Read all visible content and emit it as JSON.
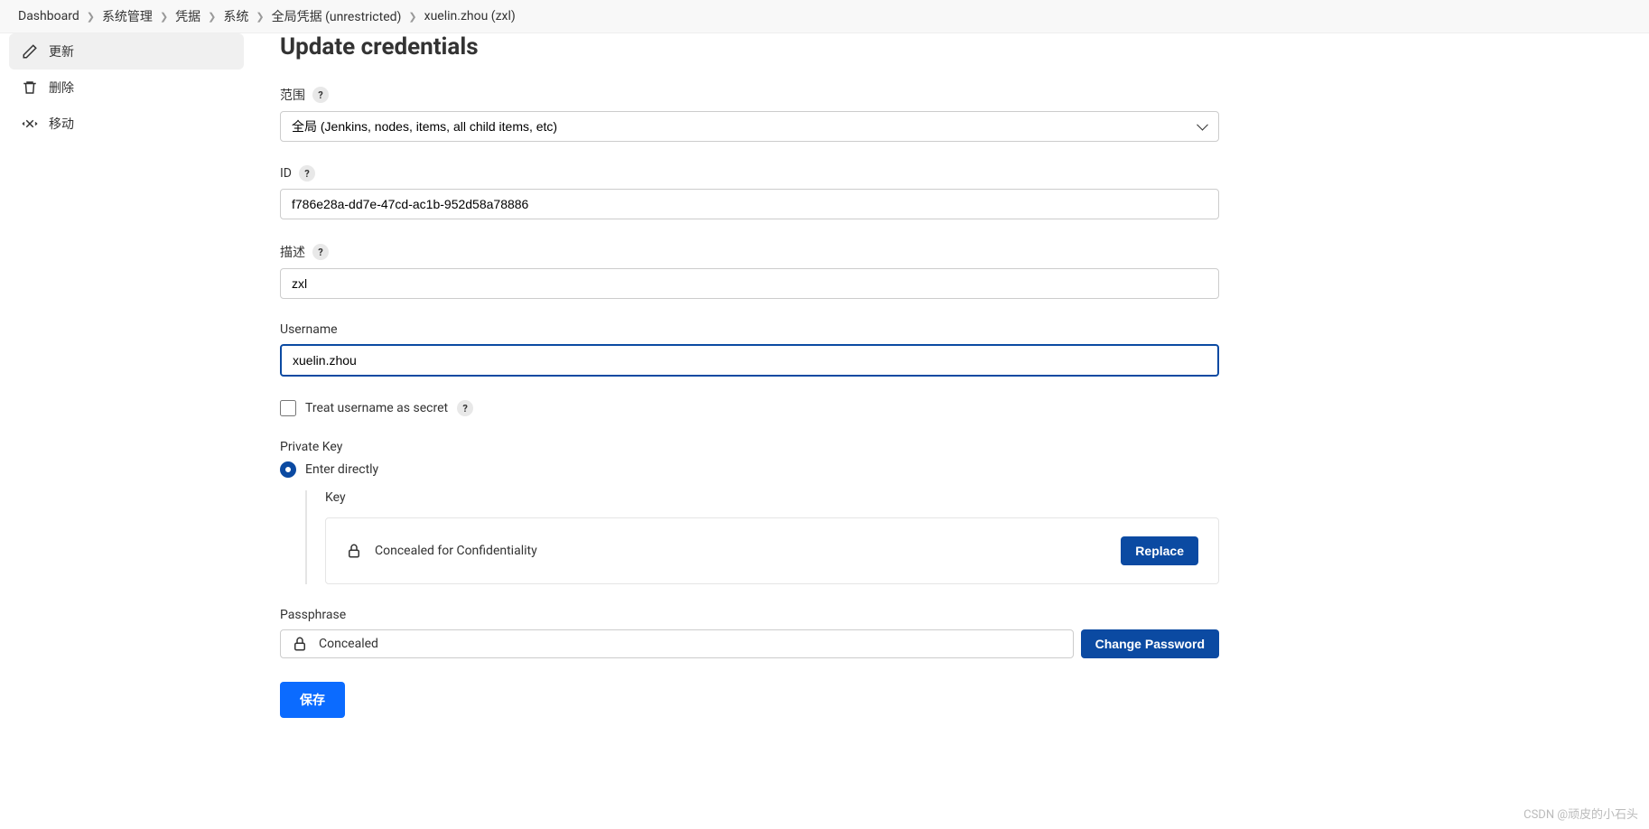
{
  "breadcrumb": [
    "Dashboard",
    "系统管理",
    "凭据",
    "系统",
    "全局凭据 (unrestricted)",
    "xuelin.zhou (zxl)"
  ],
  "sidebar": {
    "update": "更新",
    "delete": "删除",
    "move": "移动"
  },
  "page": {
    "title": "Update credentials"
  },
  "form": {
    "scope_label": "范围",
    "scope_value": "全局 (Jenkins, nodes, items, all child items, etc)",
    "id_label": "ID",
    "id_value": "f786e28a-dd7e-47cd-ac1b-952d58a78886",
    "desc_label": "描述",
    "desc_value": "zxl",
    "username_label": "Username",
    "username_value": "xuelin.zhou",
    "treat_secret_label": "Treat username as secret",
    "private_key_label": "Private Key",
    "enter_directly_label": "Enter directly",
    "key_label": "Key",
    "concealed_text": "Concealed for Confidentiality",
    "replace_label": "Replace",
    "passphrase_label": "Passphrase",
    "passphrase_value": "Concealed",
    "change_password_label": "Change Password",
    "save_label": "保存"
  },
  "watermark": "CSDN @顽皮的小石头"
}
